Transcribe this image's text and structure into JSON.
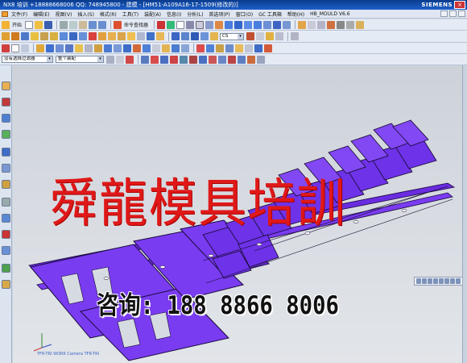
{
  "window": {
    "title": "NX8 培训 +18888668006 QQ: 748945800 - 建模 - [HM51-A109A16-17-1509(修改的)]",
    "brand": "SIEMENS",
    "close": "×"
  },
  "menu": {
    "items": [
      "文件(F)",
      "编辑(E)",
      "视图(V)",
      "插入(S)",
      "格式(R)",
      "工具(T)",
      "装配(A)",
      "信息(I)",
      "分析(L)",
      "首选项(P)",
      "窗口(O)",
      "GC 工具箱",
      "帮助(H)",
      "HB_MOULD V6.6"
    ]
  },
  "toolbar1": {
    "start_label": "开始",
    "command_finder": "命令查找器"
  },
  "toolbar2": {
    "combo_value": "CS"
  },
  "toolbar4": {
    "filter_label": "没有选择过滤器",
    "assembly_label": "整个装配"
  },
  "overlay": {
    "watermark": "舜龍模具培訓",
    "phone": "咨询: 188 8866 8006"
  },
  "status": {
    "text": "TFR-TRI WORK Camera TFR-TRI"
  },
  "colors": {
    "part_fill": "#7a3cf0",
    "part_edge": "#1a0a40",
    "watermark": "#e01818",
    "titlebar": "#0a3c8e"
  }
}
